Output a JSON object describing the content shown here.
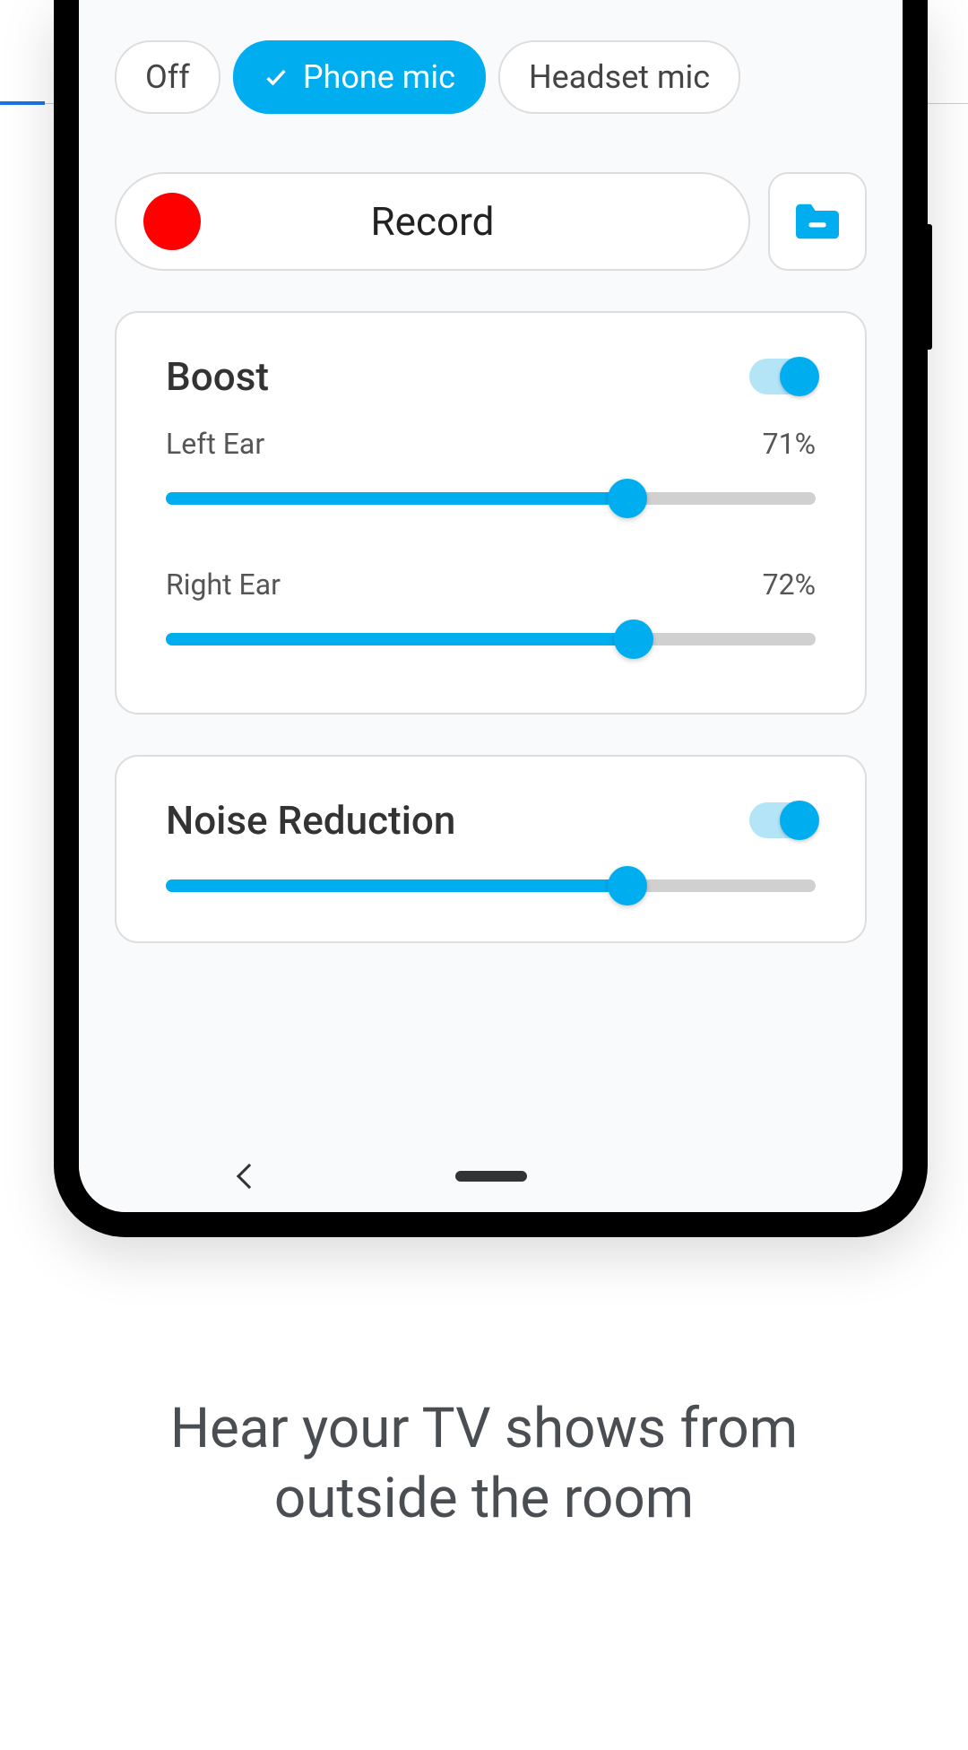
{
  "mic_options": {
    "off": "Off",
    "phone": "Phone mic",
    "headset": "Headset mic"
  },
  "record": {
    "label": "Record"
  },
  "boost": {
    "title": "Boost",
    "left_ear": {
      "label": "Left Ear",
      "value": "71%",
      "percent": 71
    },
    "right_ear": {
      "label": "Right Ear",
      "value": "72%",
      "percent": 72
    }
  },
  "noise_reduction": {
    "title": "Noise Reduction",
    "percent": 71
  },
  "tagline": "Hear your TV shows from outside the room"
}
